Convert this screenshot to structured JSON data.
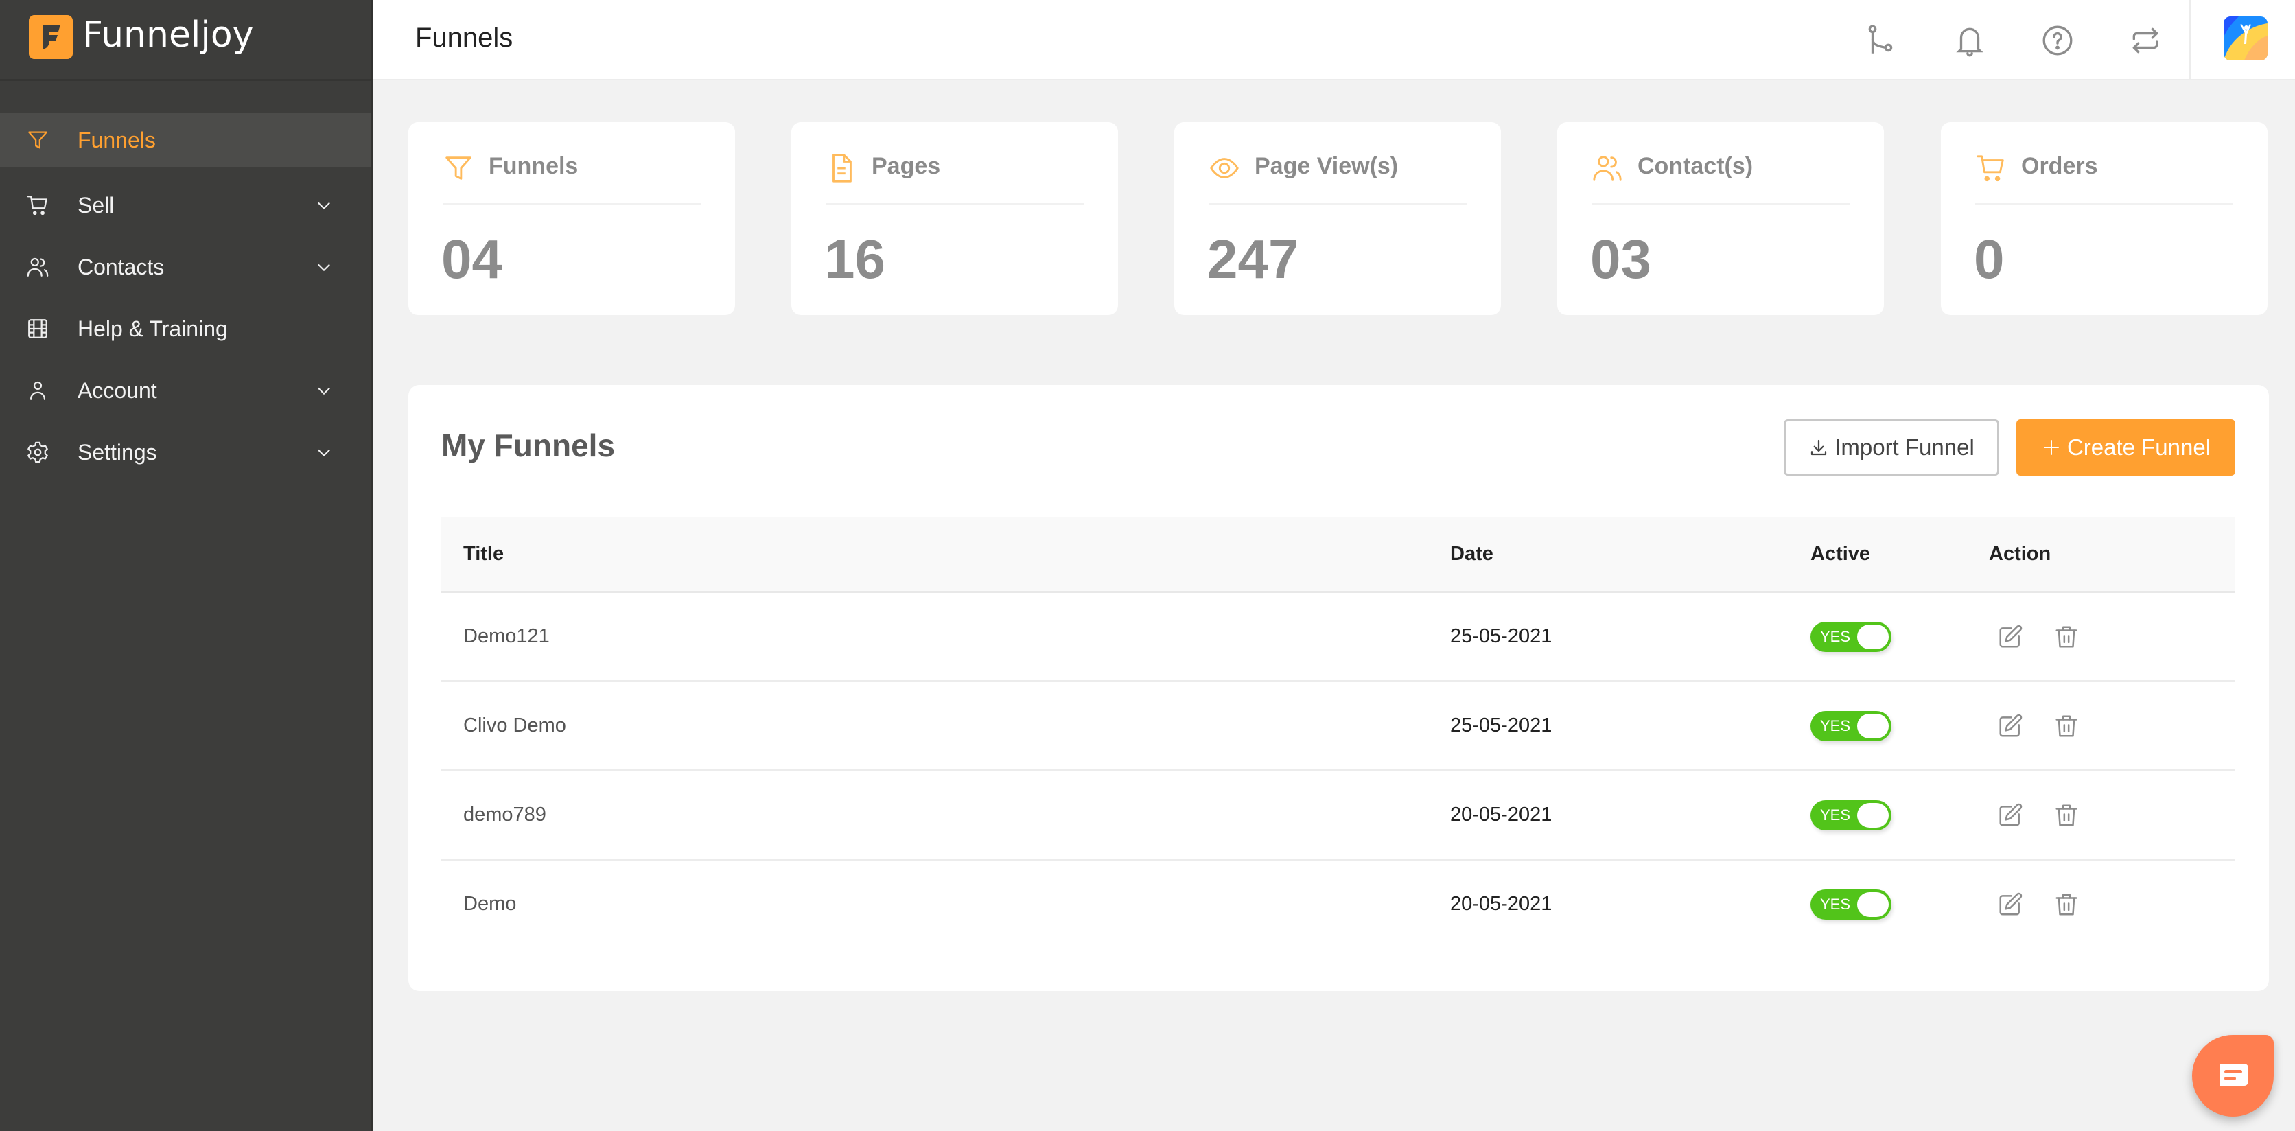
{
  "brand": {
    "name": "Funneljoy",
    "logo_letter": "F",
    "accent": "#ffa030"
  },
  "sidebar": {
    "items": [
      {
        "label": "Funnels",
        "icon": "funnel-icon",
        "active": true,
        "expandable": false
      },
      {
        "label": "Sell",
        "icon": "cart-icon",
        "active": false,
        "expandable": true
      },
      {
        "label": "Contacts",
        "icon": "users-icon",
        "active": false,
        "expandable": true
      },
      {
        "label": "Help & Training",
        "icon": "film-icon",
        "active": false,
        "expandable": false
      },
      {
        "label": "Account",
        "icon": "user-icon",
        "active": false,
        "expandable": true
      },
      {
        "label": "Settings",
        "icon": "gear-icon",
        "active": false,
        "expandable": true
      }
    ]
  },
  "header": {
    "title": "Funnels",
    "icons": [
      "branch-icon",
      "bell-icon",
      "help-icon",
      "sync-icon"
    ],
    "avatar": "avatar"
  },
  "stats": [
    {
      "label": "Funnels",
      "value": "04",
      "icon": "funnel-icon"
    },
    {
      "label": "Pages",
      "value": "16",
      "icon": "page-icon"
    },
    {
      "label": "Page View(s)",
      "value": "247",
      "icon": "eye-icon"
    },
    {
      "label": "Contact(s)",
      "value": "03",
      "icon": "users-icon"
    },
    {
      "label": "Orders",
      "value": "0",
      "icon": "cart-icon"
    }
  ],
  "funnels": {
    "title": "My Funnels",
    "import_label": "Import Funnel",
    "create_label": "Create Funnel",
    "columns": {
      "title": "Title",
      "date": "Date",
      "active": "Active",
      "action": "Action"
    },
    "rows": [
      {
        "title": "Demo121",
        "date": "25-05-2021",
        "active": "YES"
      },
      {
        "title": "Clivo Demo",
        "date": "25-05-2021",
        "active": "YES"
      },
      {
        "title": "demo789",
        "date": "20-05-2021",
        "active": "YES"
      },
      {
        "title": "Demo",
        "date": "20-05-2021",
        "active": "YES"
      }
    ]
  },
  "colors": {
    "sidebar_bg": "#3d3d3b",
    "accent": "#ffa030",
    "toggle_on": "#52c41a",
    "chat": "#ff7e50"
  }
}
